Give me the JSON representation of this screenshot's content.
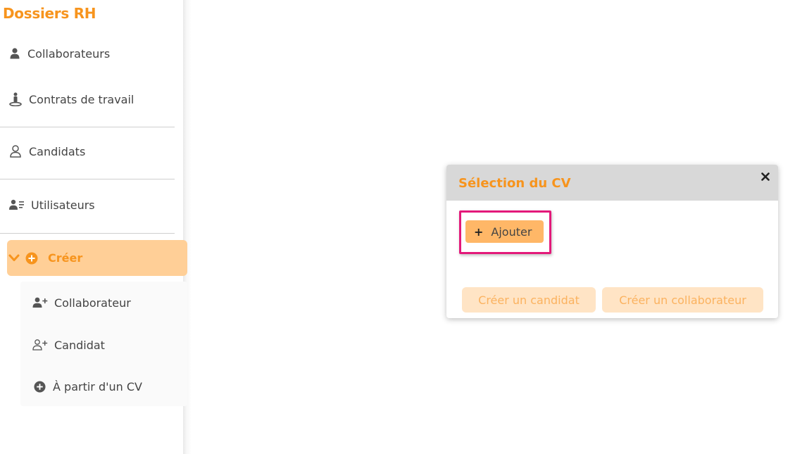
{
  "sidebar": {
    "brand": "Dossiers RH",
    "items": [
      {
        "label": "Collaborateurs",
        "icon": "user-icon"
      },
      {
        "label": "Contrats de travail",
        "icon": "contract-person-icon"
      },
      {
        "label": "Candidats",
        "icon": "user-outline-icon"
      },
      {
        "label": "Utilisateurs",
        "icon": "user-list-icon"
      }
    ],
    "create": {
      "label": "Créer",
      "expanded": true,
      "icons": [
        "chevron-down-icon",
        "plus-circle-icon"
      ],
      "submenu": [
        {
          "label": "Collaborateur",
          "icon": "user-plus-icon"
        },
        {
          "label": "Candidat",
          "icon": "user-plus-outline-icon"
        },
        {
          "label": "À partir d'un CV",
          "icon": "plus-circle-icon"
        }
      ]
    }
  },
  "modal": {
    "title": "Sélection du CV",
    "close_icon": "close-icon",
    "add_label": "Ajouter",
    "add_icon": "plus-icon",
    "create_candidate_label": "Créer un candidat",
    "create_collaborator_label": "Créer un collaborateur"
  },
  "colors": {
    "accent": "#f7941d",
    "create_bg": "#ffcf97",
    "add_button_bg": "#ffb767",
    "ghost_button_bg": "#ffe4c5",
    "highlight": "#e3197a",
    "modal_header_bg": "#d8d8d8"
  }
}
